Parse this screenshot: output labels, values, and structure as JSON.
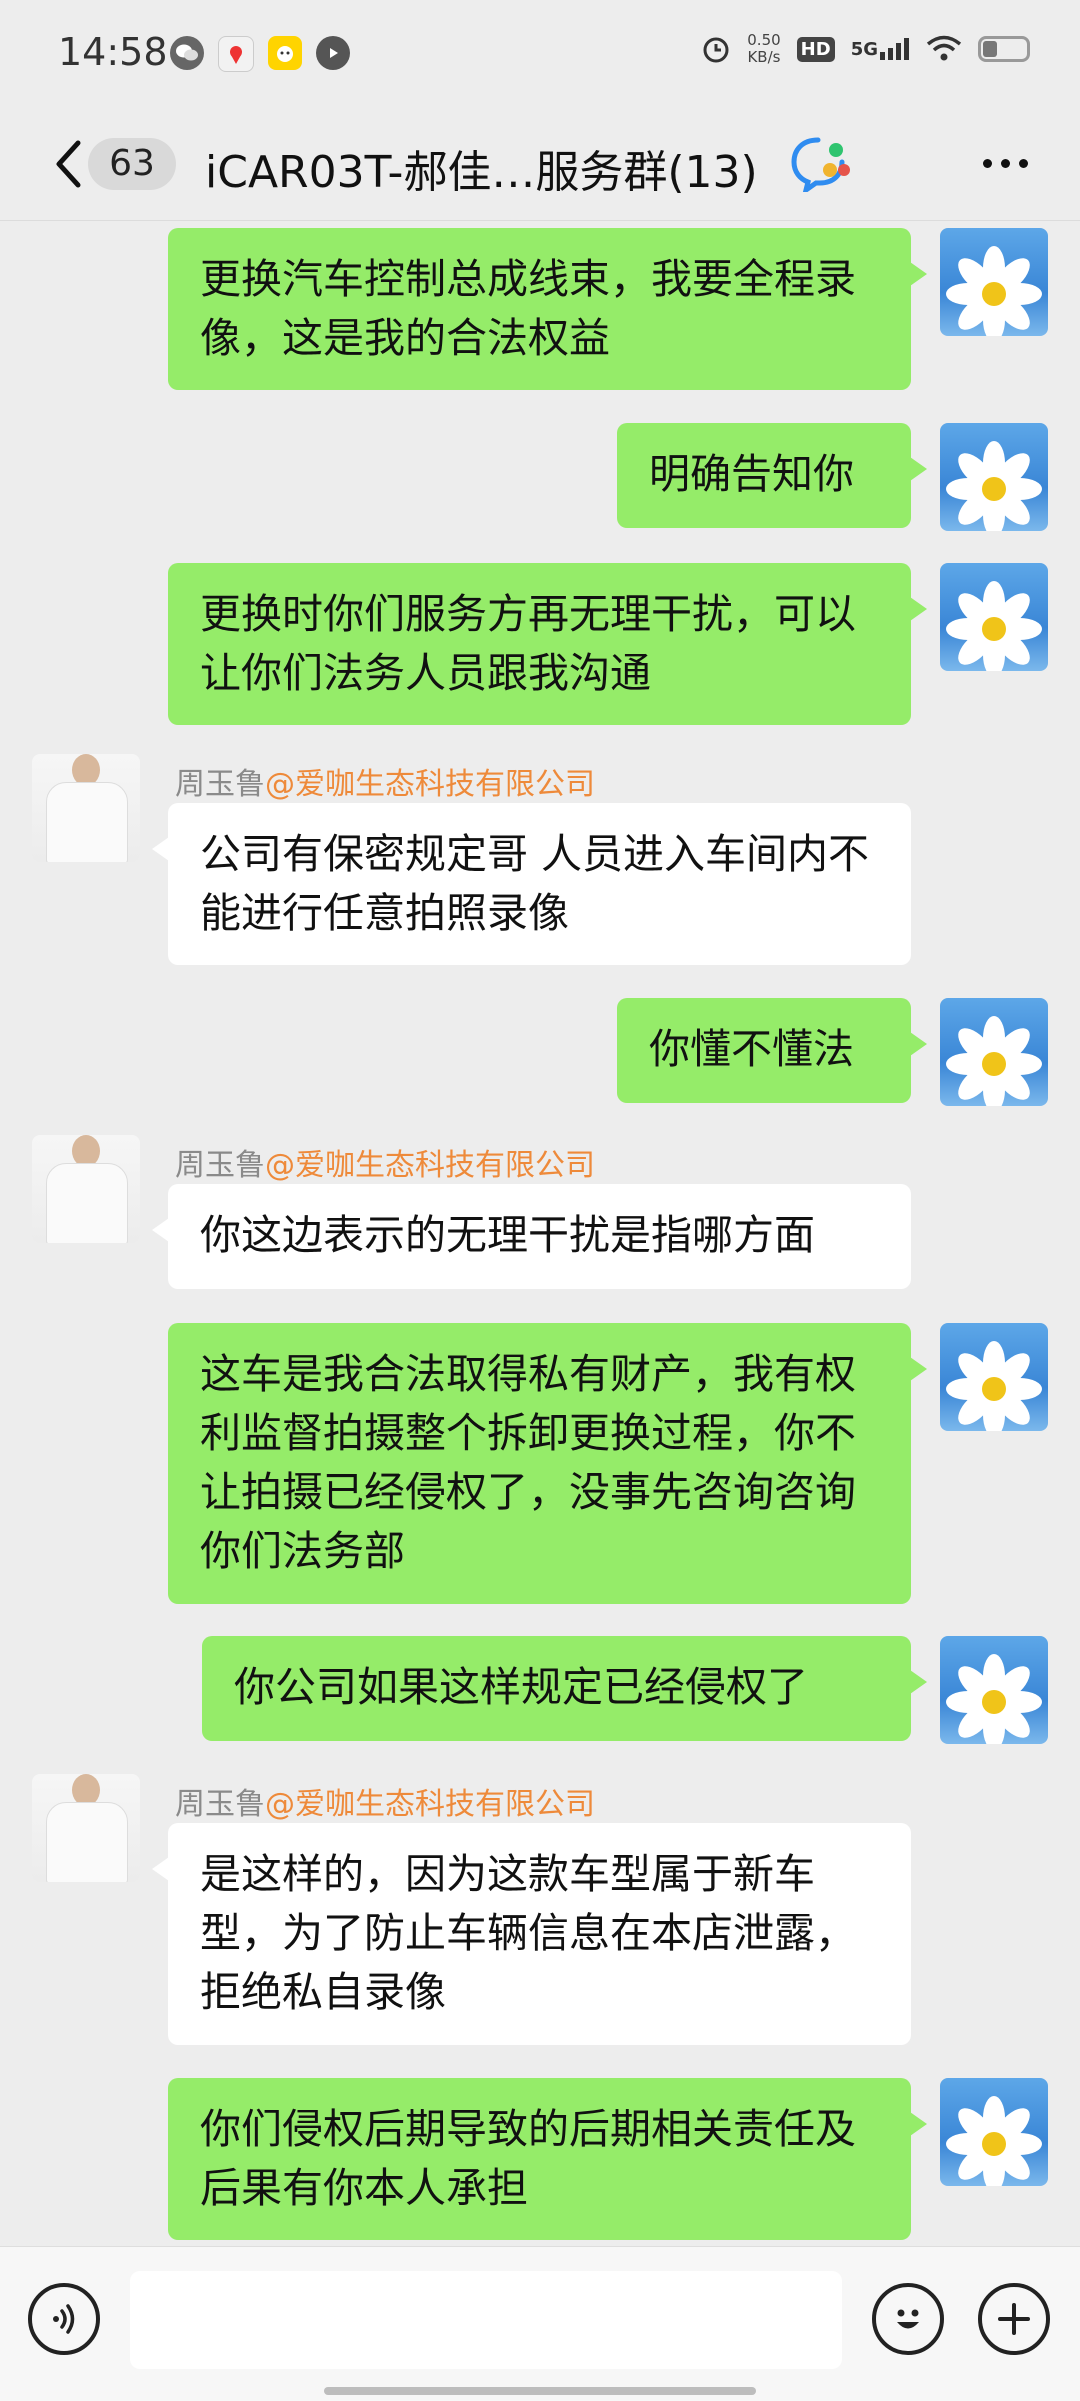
{
  "status_bar": {
    "time": "14:58",
    "net_speed_value": "0.50",
    "net_speed_unit": "KB/s",
    "hd": "HD",
    "network": "5G",
    "battery_level": 0.3
  },
  "header": {
    "unread_count": "63",
    "title": "iCAR03T-郝佳…服务群(13)"
  },
  "messages": [
    {
      "side": "self",
      "text": "更换汽车控制总成线束，我要全程录像，这是我的合法权益"
    },
    {
      "side": "self",
      "text": "明确告知你"
    },
    {
      "side": "self",
      "text": "更换时你们服务方再无理干扰，可以让你们法务人员跟我沟通"
    },
    {
      "side": "other",
      "sender": "周玉鲁",
      "org": "@爱咖生态科技有限公司",
      "text": "公司有保密规定哥  人员进入车间内不能进行任意拍照录像"
    },
    {
      "side": "self",
      "text": "你懂不懂法"
    },
    {
      "side": "other",
      "sender": "周玉鲁",
      "org": "@爱咖生态科技有限公司",
      "text": "你这边表示的无理干扰是指哪方面"
    },
    {
      "side": "self",
      "text": "这车是我合法取得私有财产，我有权利监督拍摄整个拆卸更换过程，你不让拍摄已经侵权了，没事先咨询咨询你们法务部"
    },
    {
      "side": "self",
      "text": "你公司如果这样规定已经侵权了"
    },
    {
      "side": "other",
      "sender": "周玉鲁",
      "org": "@爱咖生态科技有限公司",
      "text": "是这样的，因为这款车型属于新车型，为了防止车辆信息在本店泄露，拒绝私自录像"
    },
    {
      "side": "self",
      "text": "你们侵权后期导致的后期相关责任及后果有你本人承担"
    }
  ],
  "input": {
    "value": ""
  }
}
